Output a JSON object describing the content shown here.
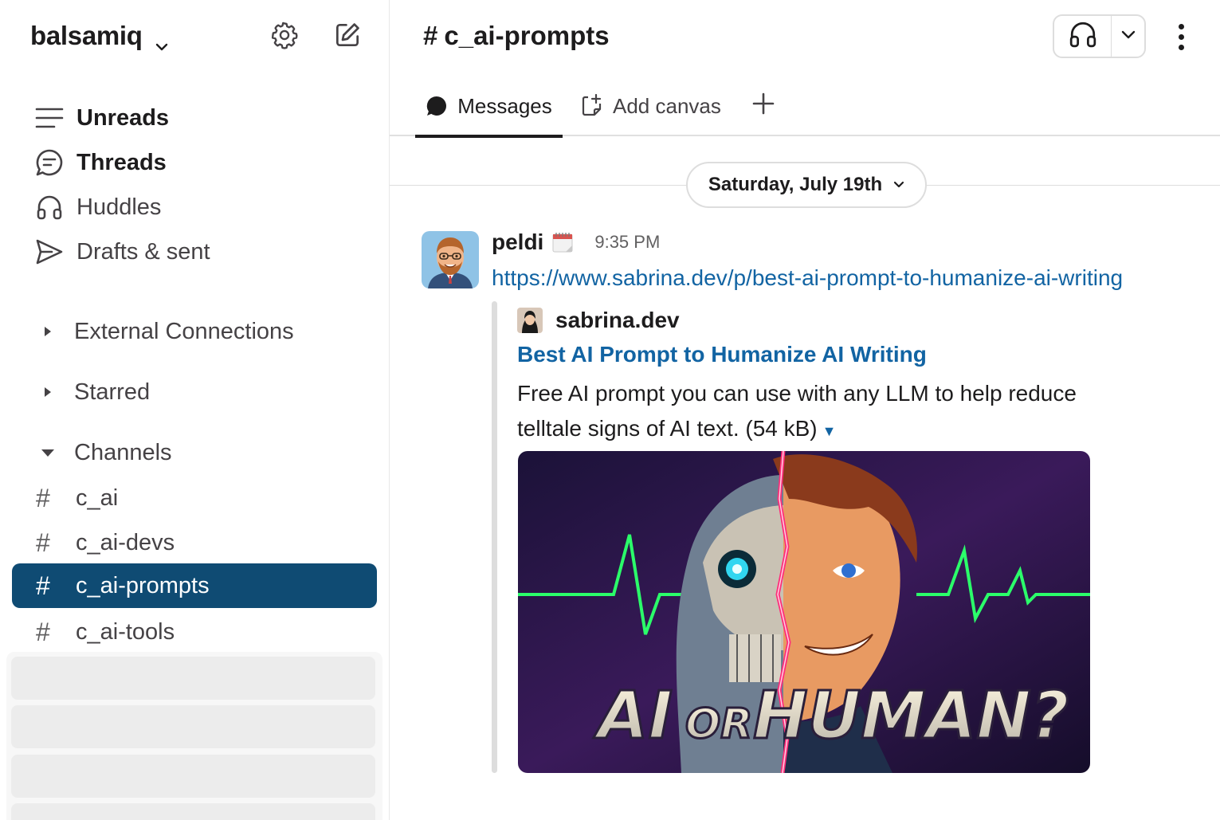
{
  "workspace": {
    "name": "balsamiq"
  },
  "nav": {
    "unreads": "Unreads",
    "threads": "Threads",
    "huddles": "Huddles",
    "drafts": "Drafts & sent"
  },
  "sections": {
    "external": "External Connections",
    "starred": "Starred",
    "channels": "Channels"
  },
  "channels": [
    {
      "name": "c_ai"
    },
    {
      "name": "c_ai-devs"
    },
    {
      "name": "c_ai-prompts"
    },
    {
      "name": "c_ai-tools"
    }
  ],
  "channel_header": {
    "hash": "#",
    "name": "c_ai-prompts"
  },
  "tabs": {
    "messages": "Messages",
    "add_canvas": "Add canvas"
  },
  "date_divider": "Saturday, July 19th",
  "message": {
    "sender": "peldi",
    "time": "9:35 PM",
    "link": "https://www.sabrina.dev/p/best-ai-prompt-to-humanize-ai-writing",
    "unfurl": {
      "site": "sabrina.dev",
      "title": "Best AI Prompt to Humanize AI Writing",
      "description": "Free AI prompt you can use with any LLM to help reduce telltale signs of AI text. (54 kB)",
      "image_text_1": "AI",
      "image_text_2": "OR",
      "image_text_3": "HUMAN?"
    }
  },
  "colors": {
    "active_channel": "#0f4b73",
    "link": "#1264a3",
    "text": "#1d1c1d"
  }
}
